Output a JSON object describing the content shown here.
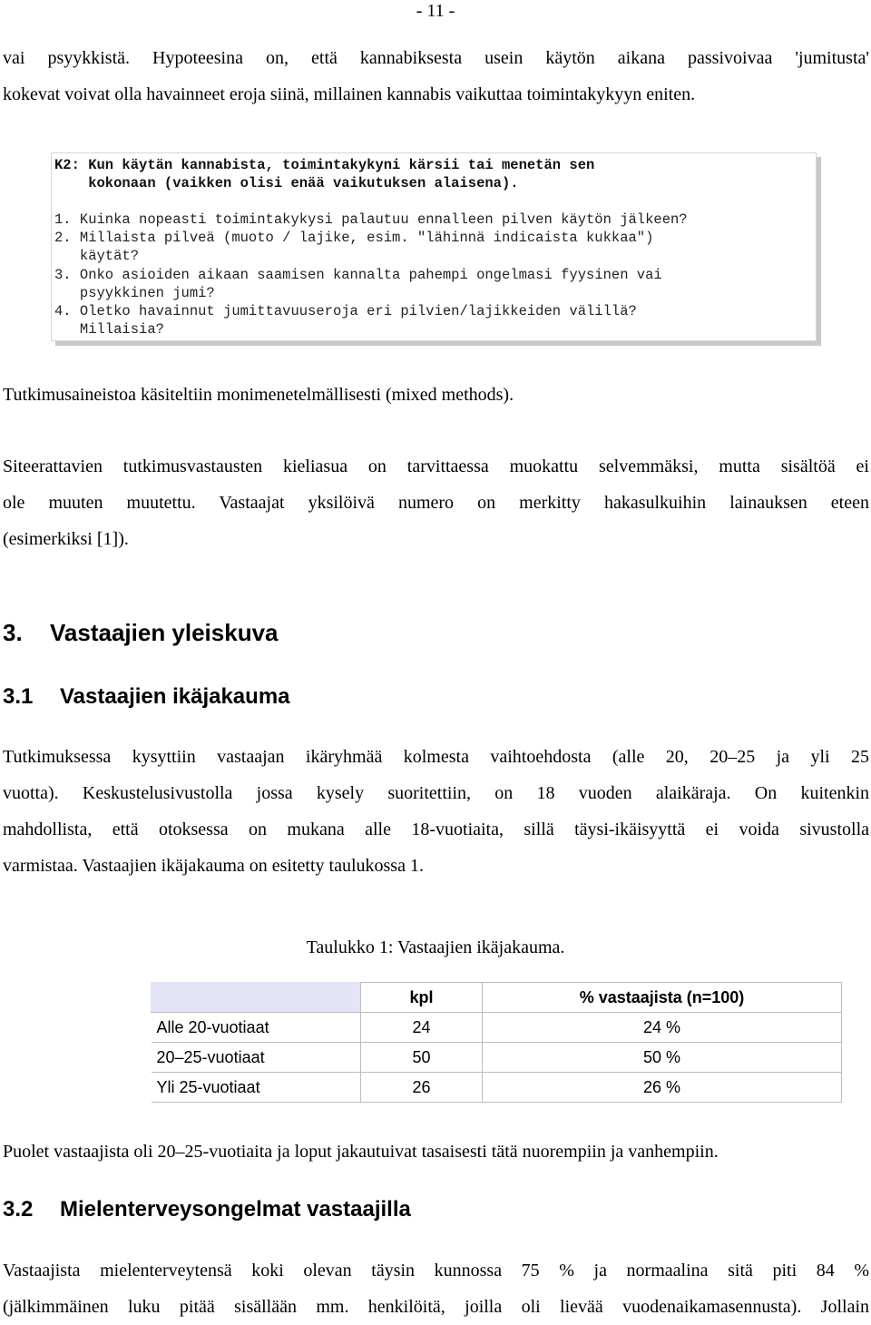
{
  "page_number": "- 11 -",
  "intro_paragraph": {
    "line1": "vai psyykkistä. Hypoteesina on, että kannabiksesta usein käytön aikana passivoivaa 'jumitusta'",
    "line2": "kokevat voivat olla havainneet eroja siinä, millainen kannabis vaikuttaa toimintakykyyn eniten."
  },
  "question_box": {
    "title_line1": "K2: Kun käytän kannabista, toimintakykyni kärsii tai menetän sen",
    "title_line2": "    kokonaan (vaikken olisi enää vaikutuksen alaisena).",
    "items": [
      "1. Kuinka nopeasti toimintakykysi palautuu ennalleen pilven käytön jälkeen?",
      "2. Millaista pilveä (muoto / lajike, esim. \"lähinnä indicaista kukkaa\")",
      "   käytät?",
      "3. Onko asioiden aikaan saamisen kannalta pahempi ongelmasi fyysinen vai",
      "   psyykkinen jumi?",
      "4. Oletko havainnut jumittavuuseroja eri pilvien/lajikkeiden välillä?",
      "   Millaisia?"
    ]
  },
  "methods_paragraph": "Tutkimusaineistoa käsiteltiin monimenetelmällisesti (mixed methods).",
  "quotes_paragraph": {
    "line1": "Siteerattavien tutkimusvastausten kieliasua on tarvittaessa muokattu selvemmäksi, mutta sisältöä ei",
    "line2": "ole muuten muutettu. Vastaajat yksilöivä numero on merkitty hakasulkuihin lainauksen eteen",
    "line3": "(esimerkiksi [1])."
  },
  "section3": {
    "number": "3.",
    "title": "Vastaajien yleiskuva"
  },
  "section3_1": {
    "number": "3.1",
    "title": "Vastaajien ikäjakauma",
    "paragraph": {
      "line1": "Tutkimuksessa kysyttiin vastaajan ikäryhmää kolmesta vaihtoehdosta (alle 20, 20–25 ja yli 25",
      "line2": "vuotta). Keskustelusivustolla jossa kysely suoritettiin, on 18 vuoden alaikäraja. On kuitenkin",
      "line3": "mahdollista, että otoksessa on mukana alle 18-vuotiaita, sillä täysi-ikäisyyttä ei voida sivustolla",
      "line4": "varmistaa. Vastaajien ikäjakauma on esitetty taulukossa 1."
    }
  },
  "table": {
    "caption": "Taulukko 1: Vastaajien ikäjakauma.",
    "headers": [
      "",
      "kpl",
      "% vastaajista (n=100)"
    ],
    "rows": [
      [
        "Alle 20-vuotiaat",
        "24",
        "24 %"
      ],
      [
        "20–25-vuotiaat",
        "50",
        "50 %"
      ],
      [
        "Yli 25-vuotiaat",
        "26",
        "26 %"
      ]
    ]
  },
  "summary_paragraph": "Puolet vastaajista oli 20–25-vuotiaita ja loput jakautuivat tasaisesti tätä nuorempiin ja vanhempiin.",
  "section3_2": {
    "number": "3.2",
    "title": "Mielenterveysongelmat vastaajilla",
    "paragraph": {
      "line1": "Vastaajista mielenterveytensä koki olevan täysin kunnossa 75 % ja normaalina sitä piti 84 %",
      "line2": "(jälkimmäinen luku pitää sisällään mm. henkilöitä, joilla oli lievää vuodenaikamasennusta). Jollain"
    }
  }
}
